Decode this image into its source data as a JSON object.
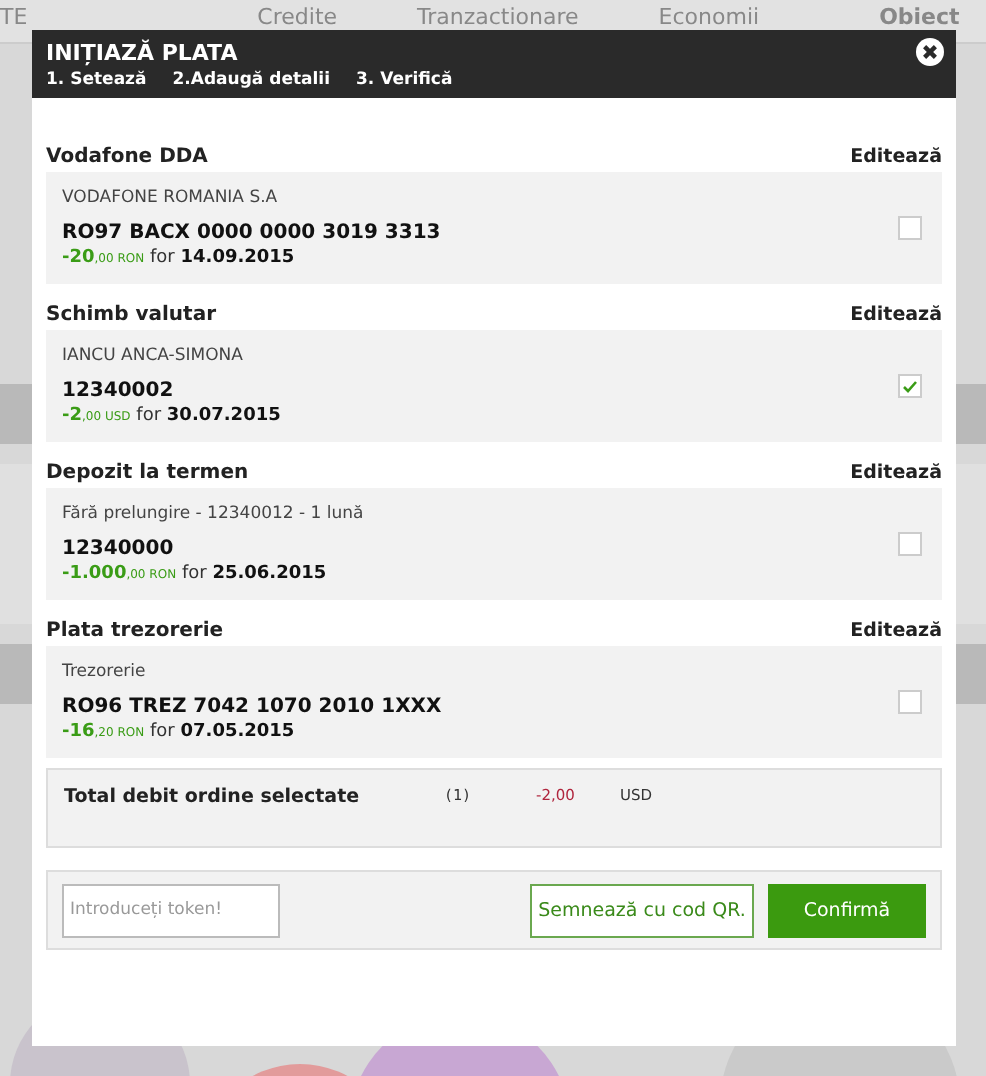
{
  "background_nav": [
    "TE",
    "Credite",
    "Tranzactionare",
    "Economii",
    "Obiect"
  ],
  "dialog": {
    "title": "INIȚIAZĂ PLATA",
    "steps": [
      "1. Setează",
      "2.Adaugă detalii",
      "3. Verifică"
    ]
  },
  "payments": [
    {
      "name": "Vodafone DDA",
      "edit": "Editează",
      "beneficiary": "VODAFONE ROMANIA S.A",
      "account": "RO97 BACX 0000 0000 3019 3313",
      "amount": "-20",
      "cents": ",00",
      "currency": "RON",
      "for_label": "for",
      "date": "14.09.2015",
      "checked": false
    },
    {
      "name": "Schimb valutar",
      "edit": "Editează",
      "beneficiary": "IANCU ANCA-SIMONA",
      "account": "12340002",
      "amount": "-2",
      "cents": ",00",
      "currency": "USD",
      "for_label": "for",
      "date": "30.07.2015",
      "checked": true
    },
    {
      "name": "Depozit la termen",
      "edit": "Editează",
      "beneficiary": "Fără prelungire - 12340012 - 1 lună",
      "account": "12340000",
      "amount": "-1.000",
      "cents": ",00",
      "currency": "RON",
      "for_label": "for",
      "date": "25.06.2015",
      "checked": false
    },
    {
      "name": "Plata trezorerie",
      "edit": "Editează",
      "beneficiary": "Trezorerie",
      "account": "RO96 TREZ 7042 1070 2010 1XXX",
      "amount": "-16",
      "cents": ",20",
      "currency": "RON",
      "for_label": "for",
      "date": "07.05.2015",
      "checked": false
    }
  ],
  "total": {
    "label": "Total debit ordine selectate",
    "count": "(1)",
    "amount": "-2,00",
    "currency": "USD"
  },
  "footer": {
    "token_placeholder": "Introduceți token!",
    "qr_button": "Semnează cu cod QR.",
    "confirm_button": "Confirmă"
  }
}
